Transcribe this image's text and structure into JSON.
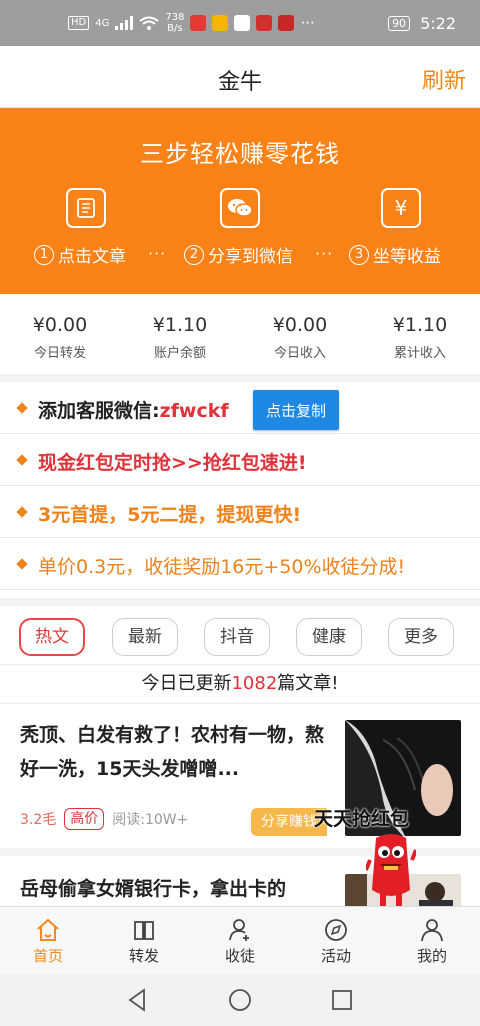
{
  "status_bar": {
    "hd": "HD",
    "network": "4G",
    "speed_top": "738",
    "speed_bottom": "B/s",
    "more": "···",
    "battery": "90",
    "time": "5:22"
  },
  "header": {
    "title": "金牛",
    "refresh_label": "刷新"
  },
  "banner": {
    "title": "三步轻松赚零花钱",
    "steps": [
      {
        "num": "1",
        "label": "点击文章",
        "icon": "article-icon"
      },
      {
        "num": "2",
        "label": "分享到微信",
        "icon": "wechat-icon"
      },
      {
        "num": "3",
        "label": "坐等收益",
        "icon": "yen-icon"
      }
    ],
    "separator": "···",
    "yen_symbol": "¥"
  },
  "stats": [
    {
      "value": "¥0.00",
      "label": "今日转发"
    },
    {
      "value": "¥1.10",
      "label": "账户余额"
    },
    {
      "value": "¥0.00",
      "label": "今日收入"
    },
    {
      "value": "¥1.10",
      "label": "累计收入"
    }
  ],
  "notices": {
    "wechat_prefix": "添加客服微信:",
    "wechat_id": "zfwckf",
    "copy_button": "点击复制",
    "red_packet": "现金红包定时抢>>抢红包速进!",
    "withdraw": "3元首提，5元二提，提现更快!",
    "price": "单价0.3元，收徒奖励16元+50%收徒分成!"
  },
  "colors": {
    "accent": "#fb8216",
    "red": "#e0323a",
    "blue_button": "#1e88e5"
  },
  "tabs": [
    {
      "label": "热文",
      "active": true
    },
    {
      "label": "最新",
      "active": false
    },
    {
      "label": "抖音",
      "active": false
    },
    {
      "label": "健康",
      "active": false
    },
    {
      "label": "更多",
      "active": false
    }
  ],
  "update_line": {
    "prefix": "今日已更新",
    "count": "1082",
    "suffix": "篇文章!"
  },
  "articles": [
    {
      "title": "秃顶、白发有救了！农村有一物，熬好一洗，15天头发噌噌...",
      "reward": "3.2毛",
      "tag": "高价",
      "reads": "阅读:10W+",
      "share": "分享赚钱"
    },
    {
      "title": "岳母偷拿女婿银行卡，拿出卡的"
    }
  ],
  "floating": {
    "badge": "天天抢红包"
  },
  "bottom_nav": [
    {
      "label": "首页",
      "icon": "home-icon",
      "active": true
    },
    {
      "label": "转发",
      "icon": "book-icon",
      "active": false
    },
    {
      "label": "收徒",
      "icon": "user-add-icon",
      "active": false
    },
    {
      "label": "活动",
      "icon": "compass-icon",
      "active": false
    },
    {
      "label": "我的",
      "icon": "profile-icon",
      "active": false
    }
  ]
}
